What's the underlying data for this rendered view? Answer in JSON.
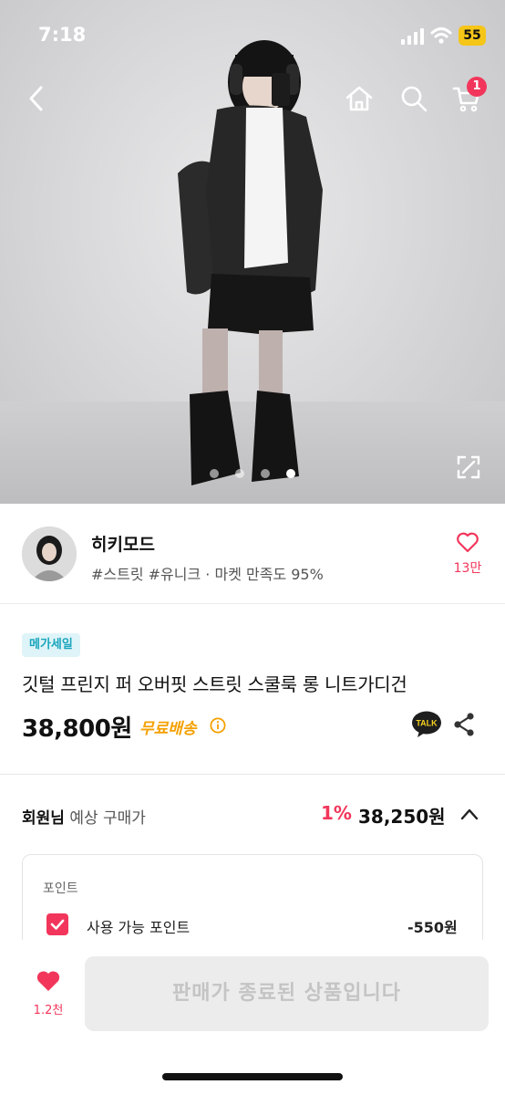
{
  "status_bar": {
    "time": "7:18",
    "battery": "55"
  },
  "nav": {
    "back_icon": "chevron-left-icon",
    "home_icon": "home-icon",
    "search_icon": "search-icon",
    "cart_icon": "cart-icon",
    "cart_count": "1"
  },
  "gallery": {
    "total": 4,
    "current": 4
  },
  "seller": {
    "name": "히키모드",
    "tags": "#스트릿 #유니크 · 마켓 만족도 95%",
    "favorite_count": "13만"
  },
  "product": {
    "badge": "메가세일",
    "title": "깃털 프린지 퍼 오버핏 스트릿 스쿨룩 롱 니트가디건",
    "price": "38,800원",
    "shipping": "무료배송",
    "talk_label": "TALK"
  },
  "member_price": {
    "label_strong": "회원님",
    "label_rest": " 예상 구매가",
    "discount": "1%",
    "price": "38,250원"
  },
  "points": {
    "title": "포인트",
    "label": "사용 가능 포인트",
    "value": "-550원",
    "checked": true
  },
  "bottom": {
    "like_count": "1.2천",
    "cta": "판매가 종료된 상품입니다"
  },
  "colors": {
    "accent": "#f2365b",
    "mega_badge_bg": "#dff4f8",
    "mega_badge_text": "#1aa5bd",
    "free_shipping": "#f5a000",
    "battery": "#f5c518"
  }
}
